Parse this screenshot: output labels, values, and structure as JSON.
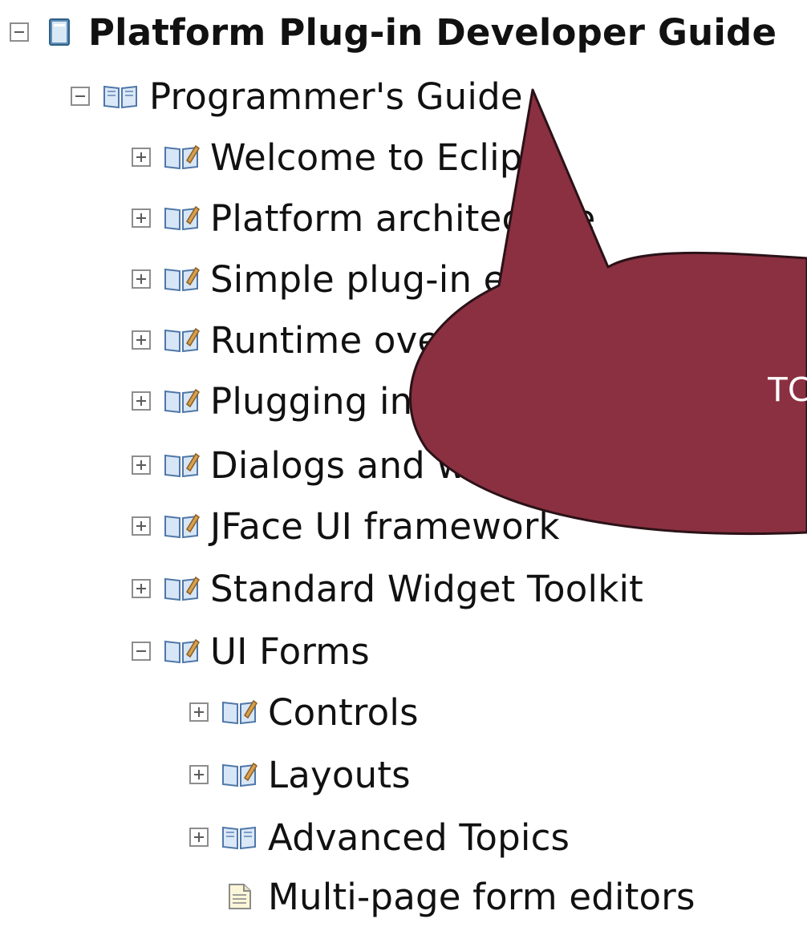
{
  "tree": [
    {
      "label": "Platform Plug-in Developer Guide",
      "state": "expanded",
      "icon": "help-book-icon",
      "bold": true
    },
    {
      "label": "Programmer's Guide",
      "state": "expanded",
      "icon": "open-book-icon"
    },
    {
      "label": "Welcome to Eclipse",
      "state": "collapsed",
      "icon": "topic-book-icon"
    },
    {
      "label": "Platform architecture",
      "state": "collapsed",
      "icon": "topic-book-icon"
    },
    {
      "label": "Simple plug-in example",
      "state": "collapsed",
      "icon": "topic-book-icon"
    },
    {
      "label": "Runtime overview",
      "state": "collapsed",
      "icon": "topic-book-icon"
    },
    {
      "label": "Plugging into the workbench",
      "state": "collapsed",
      "icon": "topic-book-icon"
    },
    {
      "label": "Dialogs and wizards",
      "state": "collapsed",
      "icon": "topic-book-icon"
    },
    {
      "label": "JFace UI framework",
      "state": "collapsed",
      "icon": "topic-book-icon"
    },
    {
      "label": "Standard Widget Toolkit",
      "state": "collapsed",
      "icon": "topic-book-icon"
    },
    {
      "label": "UI Forms",
      "state": "expanded",
      "icon": "topic-book-icon"
    },
    {
      "label": "Controls",
      "state": "collapsed",
      "icon": "topic-book-icon"
    },
    {
      "label": "Layouts",
      "state": "collapsed",
      "icon": "topic-book-icon"
    },
    {
      "label": "Advanced Topics",
      "state": "collapsed",
      "icon": "open-book-icon"
    },
    {
      "label": "Multi-page form editors",
      "state": "leaf",
      "icon": "document-icon"
    }
  ],
  "callout": {
    "text": "TOC",
    "color": "#8b3040",
    "shape": "speech-bubble"
  }
}
